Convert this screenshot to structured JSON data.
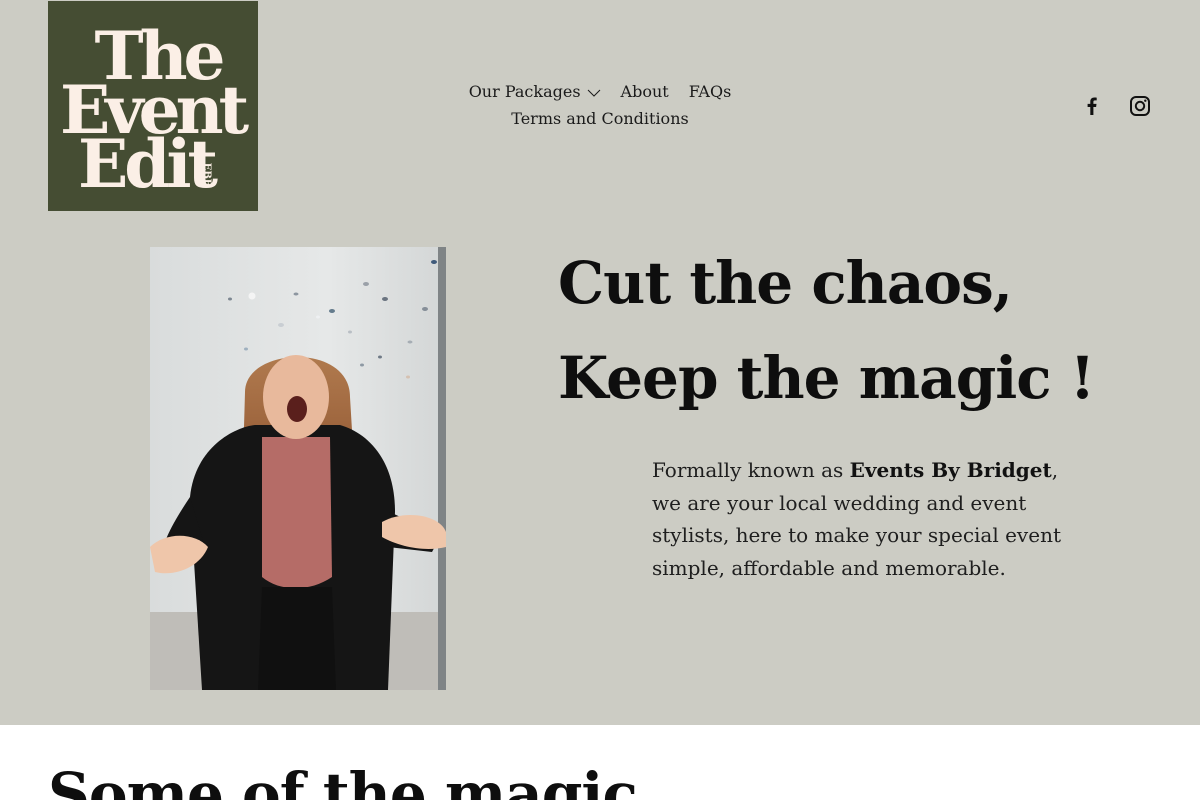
{
  "brand": {
    "logo_lines": [
      "The",
      "Event",
      "Edit"
    ],
    "logo_tag": "EBB",
    "colors": {
      "logo_bg": "#454d33",
      "logo_text": "#fbefe6",
      "page_bg": "#ccccc4"
    }
  },
  "nav": {
    "items": [
      {
        "label": "Our Packages",
        "has_dropdown": true
      },
      {
        "label": "About"
      },
      {
        "label": "FAQs"
      },
      {
        "label": "Terms and Conditions"
      }
    ]
  },
  "social": [
    {
      "icon": "facebook-icon"
    },
    {
      "icon": "instagram-icon"
    }
  ],
  "hero": {
    "headline_line1": "Cut the chaos,",
    "headline_line2": "Keep the magic !",
    "intro_prefix": "Formally known as ",
    "intro_brand": "Events By Bridget",
    "intro_suffix": ", we are your local wedding and event stylists, here to make your special event simple, affordable and memorable."
  },
  "gallery": {
    "title": "Some of the magic"
  }
}
